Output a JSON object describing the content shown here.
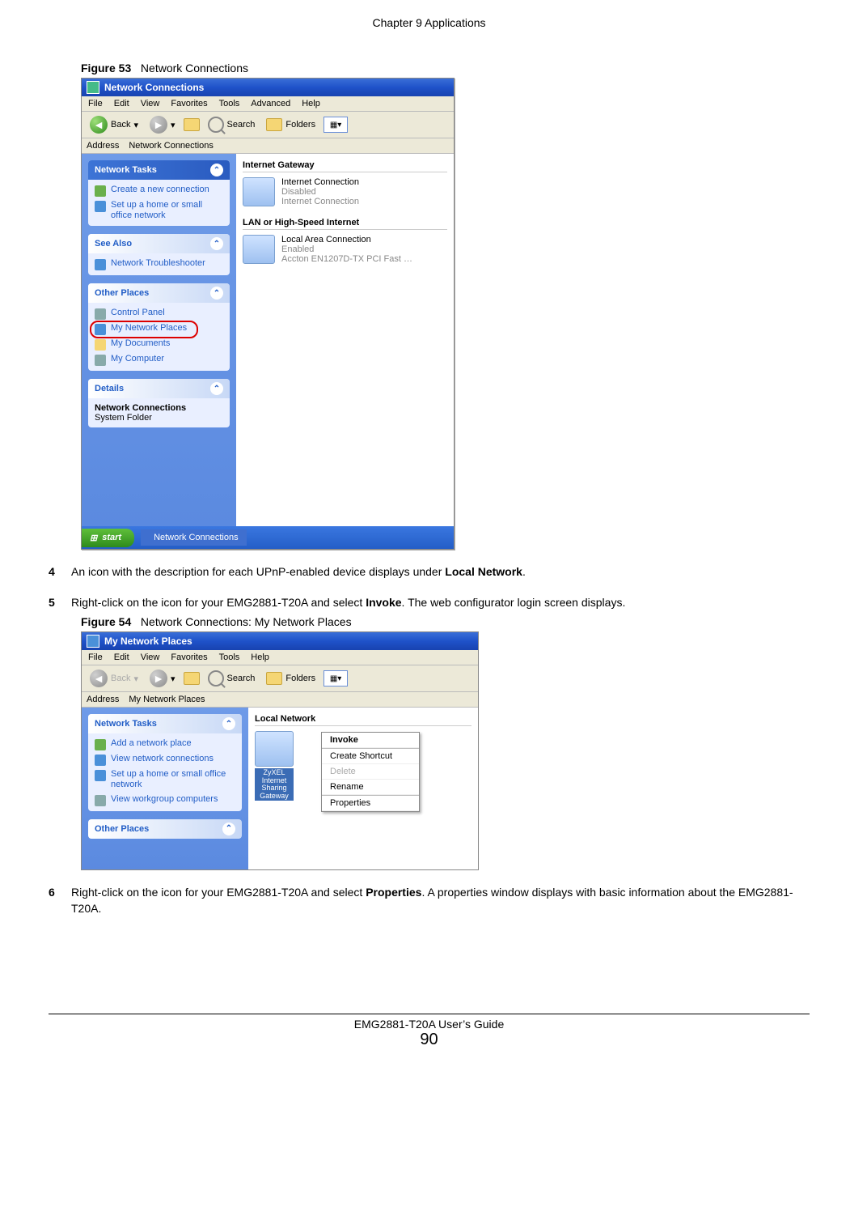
{
  "chapter_header": "Chapter 9 Applications",
  "figure53_label": "Figure 53",
  "figure53_title": "Network Connections",
  "figure54_label": "Figure 54",
  "figure54_title": "Network Connections: My Network Places",
  "step4_num": "4",
  "step4_a": "An icon with the description for each UPnP-enabled device displays under ",
  "step4_b": "Local Network",
  "step4_c": ".",
  "step5_num": "5",
  "step5_a": "Right-click on the icon for your EMG2881-T20A and select ",
  "step5_b": "Invoke",
  "step5_c": ". The web configurator login screen displays.",
  "step6_num": "6",
  "step6_a": "Right-click on the icon for your EMG2881-T20A and select ",
  "step6_b": "Properties",
  "step6_c": ". A properties window displays with basic information about the EMG2881-T20A.",
  "footer_title": "EMG2881-T20A User’s Guide",
  "footer_page": "90",
  "fig53": {
    "title": "Network Connections",
    "menu": [
      "File",
      "Edit",
      "View",
      "Favorites",
      "Tools",
      "Advanced",
      "Help"
    ],
    "back": "Back",
    "search": "Search",
    "folders": "Folders",
    "address_label": "Address",
    "address_value": "Network Connections",
    "tasks_head": "Network Tasks",
    "task1": "Create a new connection",
    "task2": "Set up a home or small office network",
    "seealso_head": "See Also",
    "seealso1": "Network Troubleshooter",
    "other_head": "Other Places",
    "other1": "Control Panel",
    "other2": "My Network Places",
    "other3": "My Documents",
    "other4": "My Computer",
    "details_head": "Details",
    "details_t": "Network Connections",
    "details_s": "System Folder",
    "grp1": "Internet Gateway",
    "conn1_t": "Internet Connection",
    "conn1_s": "Disabled",
    "conn1_d": "Internet Connection",
    "grp2": "LAN or High-Speed Internet",
    "conn2_t": "Local Area Connection",
    "conn2_s": "Enabled",
    "conn2_d": "Accton EN1207D-TX PCI Fast …",
    "start": "start",
    "taskbar_item": "Network Connections"
  },
  "fig54": {
    "title": "My Network Places",
    "menu": [
      "File",
      "Edit",
      "View",
      "Favorites",
      "Tools",
      "Help"
    ],
    "back": "Back",
    "search": "Search",
    "folders": "Folders",
    "address_label": "Address",
    "address_value": "My Network Places",
    "tasks_head": "Network Tasks",
    "task1": "Add a network place",
    "task2": "View network connections",
    "task3": "Set up a home or small office network",
    "task4": "View workgroup computers",
    "other_head": "Other Places",
    "grp1": "Local Network",
    "dev_line1": "ZyXEL",
    "dev_line2": "Internet",
    "dev_line3": "Sharing",
    "dev_line4": "Gateway",
    "ctx_invoke": "Invoke",
    "ctx_shortcut": "Create Shortcut",
    "ctx_delete": "Delete",
    "ctx_rename": "Rename",
    "ctx_props": "Properties"
  }
}
